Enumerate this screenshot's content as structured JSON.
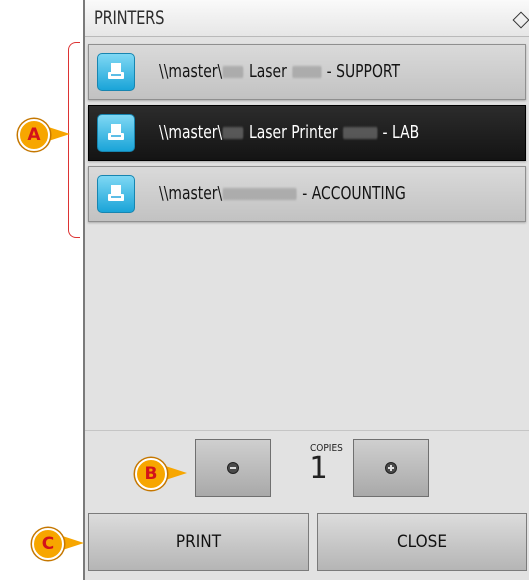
{
  "header": {
    "title": "PRINTERS",
    "sort_icon": "sort-diamond-icon"
  },
  "printers": [
    {
      "prefix": "\\\\master\\",
      "model": "Laser",
      "suffix": "- SUPPORT",
      "selected": false,
      "icon": "printer-icon"
    },
    {
      "prefix": "\\\\master\\",
      "model": "Laser Printer",
      "suffix": "- LAB",
      "selected": true,
      "icon": "printer-icon"
    },
    {
      "prefix": "\\\\master\\",
      "model": "",
      "suffix": "- ACCOUNTING",
      "selected": false,
      "icon": "printer-icon"
    }
  ],
  "copies": {
    "label": "COPIES",
    "value": "1",
    "minus_icon": "minus-icon",
    "plus_icon": "plus-icon"
  },
  "actions": {
    "print_label": "PRINT",
    "close_label": "CLOSE"
  },
  "callouts": {
    "a": "A",
    "b": "B",
    "c": "C"
  },
  "colors": {
    "selected_row": "#1a1a1a",
    "printer_icon": "#29b3e4",
    "callout": "#f7a600",
    "callout_text": "#d3121a"
  }
}
